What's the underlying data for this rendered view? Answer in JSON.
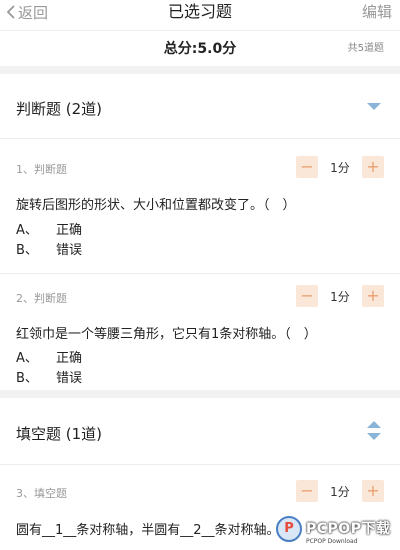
{
  "nav": {
    "back_label": "返回",
    "title": "已选习题",
    "edit_label": "编辑"
  },
  "summary": {
    "total_score": "总分:5.0分",
    "count": "共5道题"
  },
  "sections": [
    {
      "title": "判断题 (2道)",
      "questions": [
        {
          "type": "1、判断题",
          "score": "1分",
          "text": "旋转后图形的形状、大小和位置都改变了。（　）",
          "options": [
            {
              "key": "A、",
              "label": "正确"
            },
            {
              "key": "B、",
              "label": "错误"
            }
          ]
        },
        {
          "type": "2、判断题",
          "score": "1分",
          "text": "红领巾是一个等腰三角形，它只有1条对称轴。（　）",
          "options": [
            {
              "key": "A、",
              "label": "正确"
            },
            {
              "key": "B、",
              "label": "错误"
            }
          ]
        }
      ]
    },
    {
      "title": "填空题 (1道)",
      "questions": [
        {
          "type": "3、填空题",
          "score": "1分",
          "text": "圆有__1__条对称轴，半圆有__2__条对称轴。"
        }
      ]
    }
  ],
  "stepper": {
    "minus": "−",
    "plus": "+"
  },
  "watermark": {
    "logo_letter": "P",
    "text": "PCPOP下载",
    "sub": "PCPOP Download"
  },
  "colors": {
    "accent_orange": "#e8a070",
    "stepper_bg": "#fbe7d8",
    "arrow_blue": "#8ab4d8"
  },
  "icons": {
    "back": "chevron-left-icon",
    "collapse": "triangle-down-icon",
    "sort": "sort-arrows-icon"
  }
}
